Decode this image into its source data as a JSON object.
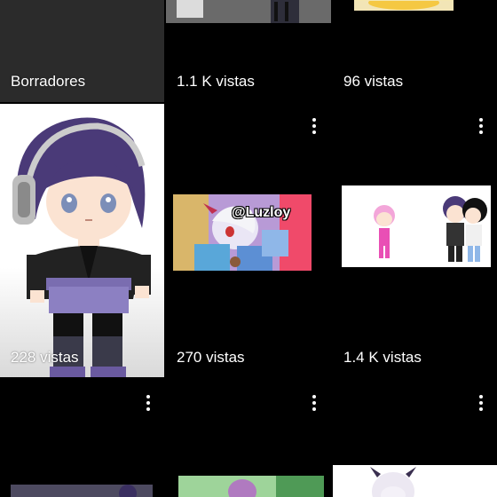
{
  "tiles": [
    {
      "label": "Borradores"
    },
    {
      "label": "1.1 K vistas"
    },
    {
      "label": "96 vistas"
    },
    {
      "label": "228 vistas"
    },
    {
      "label": "270 vistas"
    },
    {
      "label": "1.4 K vistas"
    }
  ],
  "watermark": "@Luzloy",
  "icons": {
    "menu": "more-vert-icon"
  }
}
